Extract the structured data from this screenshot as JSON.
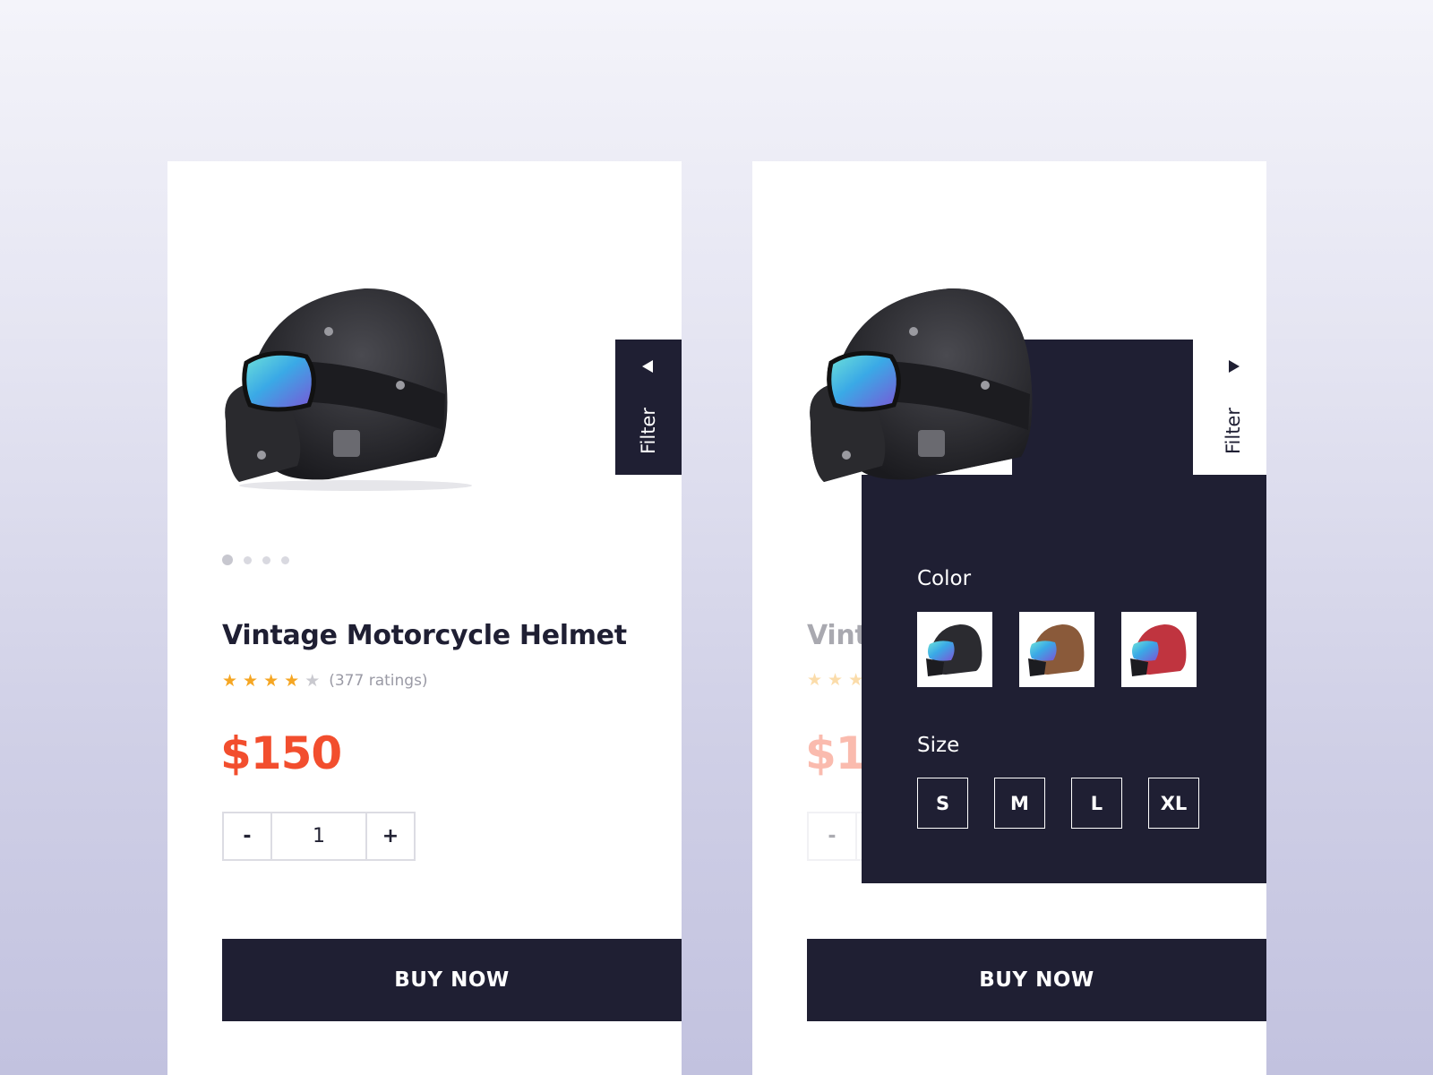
{
  "product": {
    "title": "Vintage Motorcycle Helmet",
    "rating_stars": 4,
    "rating_max": 5,
    "rating_text": "(377 ratings)",
    "price": "$150",
    "quantity": "1",
    "minus_label": "-",
    "plus_label": "+",
    "buy_label": "BUY NOW"
  },
  "carousel": {
    "slides": 4,
    "active_index": 0
  },
  "filter": {
    "tab_label": "Filter",
    "color_heading": "Color",
    "size_heading": "Size",
    "colors": [
      {
        "name": "black",
        "shell": "#2b2b30"
      },
      {
        "name": "brown",
        "shell": "#8a5a3a"
      },
      {
        "name": "red",
        "shell": "#c0343f"
      }
    ],
    "sizes": [
      "S",
      "M",
      "L",
      "XL"
    ]
  },
  "icons": {
    "filter_collapsed": "triangle-left-icon",
    "filter_expanded": "triangle-right-icon",
    "star": "star-icon"
  },
  "colors": {
    "dark": "#1f1f33",
    "price": "#f24e2e",
    "star": "#f5a623"
  }
}
